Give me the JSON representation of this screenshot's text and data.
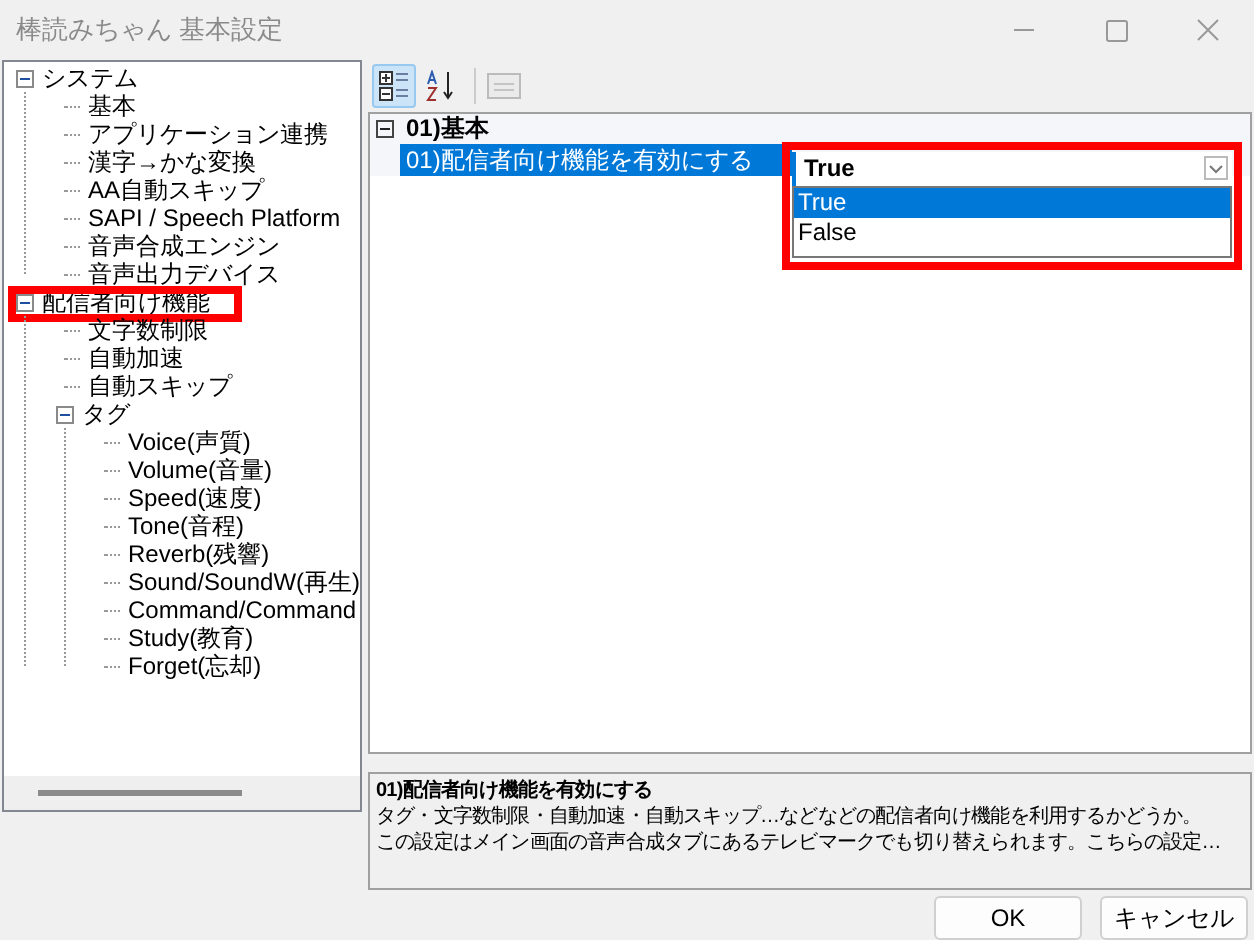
{
  "window": {
    "title": "棒読みちゃん 基本設定"
  },
  "tree": [
    {
      "label": "システム",
      "expanded": true,
      "children": [
        {
          "label": "基本"
        },
        {
          "label": "アプリケーション連携"
        },
        {
          "label": "漢字→かな変換"
        },
        {
          "label": "AA自動スキップ"
        },
        {
          "label": "SAPI / Speech Platform"
        },
        {
          "label": "音声合成エンジン"
        },
        {
          "label": "音声出力デバイス"
        }
      ]
    },
    {
      "label": "配信者向け機能",
      "expanded": true,
      "highlighted": true,
      "children": [
        {
          "label": "文字数制限"
        },
        {
          "label": "自動加速"
        },
        {
          "label": "自動スキップ"
        },
        {
          "label": "タグ",
          "expanded": true,
          "children": [
            {
              "label": "Voice(声質)"
            },
            {
              "label": "Volume(音量)"
            },
            {
              "label": "Speed(速度)"
            },
            {
              "label": "Tone(音程)"
            },
            {
              "label": "Reverb(残響)"
            },
            {
              "label": "Sound/SoundW(再生)"
            },
            {
              "label": "Command/Command"
            },
            {
              "label": "Study(教育)"
            },
            {
              "label": "Forget(忘却)"
            }
          ]
        }
      ]
    }
  ],
  "toolbar": [
    {
      "kind": "categorized",
      "selected": true
    },
    {
      "kind": "alphabetical",
      "selected": false
    },
    {
      "kind": "pages",
      "selected": false,
      "disabled": true
    }
  ],
  "grid": {
    "category": "01)基本",
    "expanded": true,
    "property": "01)配信者向け機能を有効にする",
    "value": "True",
    "highlighted": true,
    "options": [
      {
        "label": "True",
        "selected": true
      },
      {
        "label": "False",
        "selected": false
      }
    ]
  },
  "description": {
    "title": "01)配信者向け機能を有効にする",
    "lines": [
      "タグ・文字数制限・自動加速・自動スキップ…などなどの配信者向け機能を利用するかどうか。",
      "この設定はメイン画面の音声合成タブにあるテレビマークでも切り替えられます。こちらの設定…"
    ]
  },
  "buttons": [
    "OK",
    "キャンセル"
  ]
}
